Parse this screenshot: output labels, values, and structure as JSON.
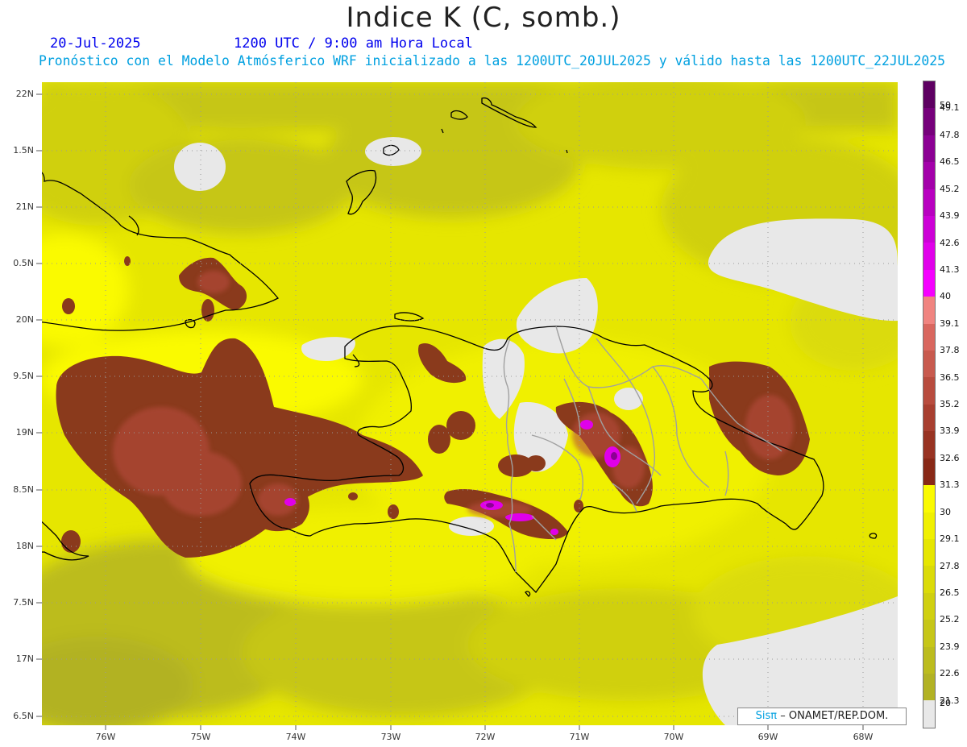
{
  "header": {
    "title": "Indice K (C, somb.)",
    "date": "20-Jul-2025",
    "time": "1200 UTC / 9:00 am Hora Local",
    "forecast": "Pronóstico con el Modelo Atmósferico WRF inicializado a las 1200UTC_20JUL2025 y válido hasta las  1200UTC_22JUL2025"
  },
  "map": {
    "lat_labels": [
      "22N",
      "1.5N",
      "21N",
      "0.5N",
      "20N",
      "9.5N",
      "19N",
      "8.5N",
      "18N",
      "7.5N",
      "17N",
      "6.5N"
    ],
    "lon_labels": [
      "76W",
      "75W",
      "74W",
      "73W",
      "72W",
      "71W",
      "70W",
      "69W",
      "68W"
    ]
  },
  "colorbar": {
    "labels": [
      "50",
      "49.1",
      "47.8",
      "46.5",
      "45.2",
      "43.9",
      "42.6",
      "41.3",
      "40",
      "39.1",
      "37.8",
      "36.5",
      "35.2",
      "33.9",
      "32.6",
      "31.3",
      "30",
      "29.1",
      "27.8",
      "26.5",
      "25.2",
      "23.9",
      "22.6",
      "21.3",
      "20"
    ],
    "colors": [
      "#5e0062",
      "#76007b",
      "#8c0094",
      "#a300aa",
      "#b800c0",
      "#cc00d6",
      "#e000ea",
      "#f500ff",
      "#f08480",
      "#d9675f",
      "#c85a4e",
      "#b84c3e",
      "#a83f30",
      "#983322",
      "#882816",
      "#fafa00",
      "#f0f000",
      "#e6e600",
      "#dbdb08",
      "#d0d010",
      "#c6c618",
      "#bcbc1e",
      "#b2b224",
      "#e8e8e8"
    ]
  },
  "credit": {
    "brand": "Sisπ",
    "text": "– ONAMET/REP.DOM."
  },
  "colors": {
    "header_blue": "#0000ee",
    "forecast_cyan": "#00a0e0",
    "brown": "#8a3a1c",
    "magenta": "#e000ea",
    "yellow": "#fafa00",
    "gray_land": "#e8e8e8"
  }
}
